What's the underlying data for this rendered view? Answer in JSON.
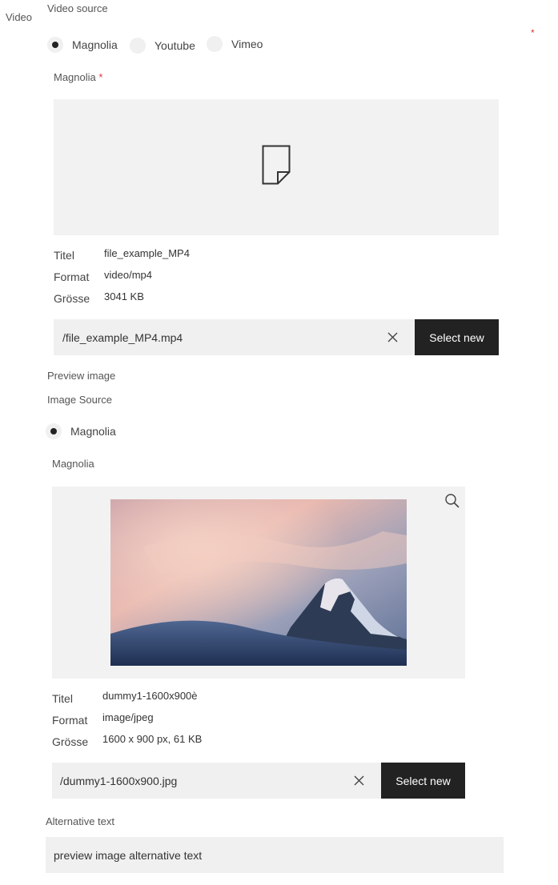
{
  "sidebar": {
    "video_label": "Video"
  },
  "video_source": {
    "label": "Video source",
    "required_mark": "*",
    "options": [
      {
        "label": "Magnolia",
        "selected": true
      },
      {
        "label": "Youtube",
        "selected": false
      },
      {
        "label": "Vimeo",
        "selected": false
      }
    ]
  },
  "video_asset": {
    "field_label": "Magnolia",
    "required_mark": "*",
    "preview_icon": "file-icon",
    "meta": {
      "title_key": "Titel",
      "title_val": "file_example_MP4",
      "format_key": "Format",
      "format_val": "video/mp4",
      "size_key": "Grösse",
      "size_val": "3041 KB"
    },
    "path": "/file_example_MP4.mp4",
    "clear_icon": "close-icon",
    "select_new": "Select new"
  },
  "preview_image": {
    "section_label": "Preview image",
    "source_label": "Image Source",
    "options": [
      {
        "label": "Magnolia",
        "selected": true
      }
    ],
    "field_label": "Magnolia",
    "zoom_icon": "search-icon",
    "meta": {
      "title_key": "Titel",
      "title_val": "dummy1-1600x900è",
      "format_key": "Format",
      "format_val": "image/jpeg",
      "size_key": "Grösse",
      "size_val": "1600 x 900 px, 61 KB"
    },
    "path": "/dummy1-1600x900.jpg",
    "clear_icon": "close-icon",
    "select_new": "Select new"
  },
  "alt_text": {
    "label": "Alternative text",
    "value": "preview image alternative text"
  }
}
